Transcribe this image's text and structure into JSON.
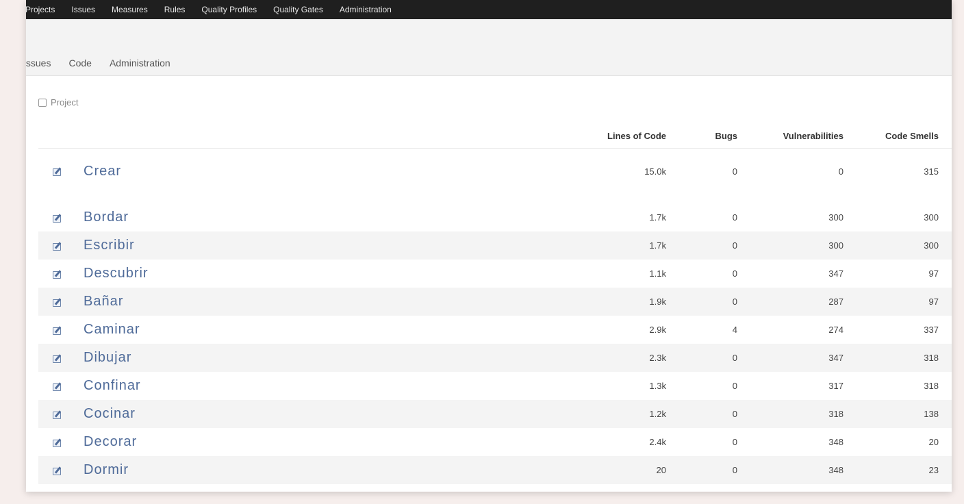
{
  "topnav": {
    "items": [
      "Projects",
      "Issues",
      "Measures",
      "Rules",
      "Quality Profiles",
      "Quality Gates",
      "Administration"
    ]
  },
  "subnav": {
    "tabs": [
      "Issues",
      "Code",
      "Administration"
    ]
  },
  "filter": {
    "label": "Project"
  },
  "table": {
    "headers": {
      "loc": "Lines of Code",
      "bugs": "Bugs",
      "vulnerabilities": "Vulnerabilities",
      "code_smells": "Code Smells"
    },
    "rows": [
      {
        "name": "Crear",
        "loc": "15.0k",
        "bugs": "0",
        "vulnerabilities": "0",
        "code_smells": "315"
      },
      {
        "name": "Bordar",
        "loc": "1.7k",
        "bugs": "0",
        "vulnerabilities": "300",
        "code_smells": "300"
      },
      {
        "name": "Escribir",
        "loc": "1.7k",
        "bugs": "0",
        "vulnerabilities": "300",
        "code_smells": "300"
      },
      {
        "name": "Descubrir",
        "loc": "1.1k",
        "bugs": "0",
        "vulnerabilities": "347",
        "code_smells": "97"
      },
      {
        "name": "Bañar",
        "loc": "1.9k",
        "bugs": "0",
        "vulnerabilities": "287",
        "code_smells": "97"
      },
      {
        "name": "Caminar",
        "loc": "2.9k",
        "bugs": "4",
        "vulnerabilities": "274",
        "code_smells": "337"
      },
      {
        "name": "Dibujar",
        "loc": "2.3k",
        "bugs": "0",
        "vulnerabilities": "347",
        "code_smells": "318"
      },
      {
        "name": "Confinar",
        "loc": "1.3k",
        "bugs": "0",
        "vulnerabilities": "317",
        "code_smells": "318"
      },
      {
        "name": "Cocinar",
        "loc": "1.2k",
        "bugs": "0",
        "vulnerabilities": "318",
        "code_smells": "138"
      },
      {
        "name": "Decorar",
        "loc": "2.4k",
        "bugs": "0",
        "vulnerabilities": "348",
        "code_smells": "20"
      },
      {
        "name": "Dormir",
        "loc": "20",
        "bugs": "0",
        "vulnerabilities": "348",
        "code_smells": "23"
      }
    ]
  }
}
